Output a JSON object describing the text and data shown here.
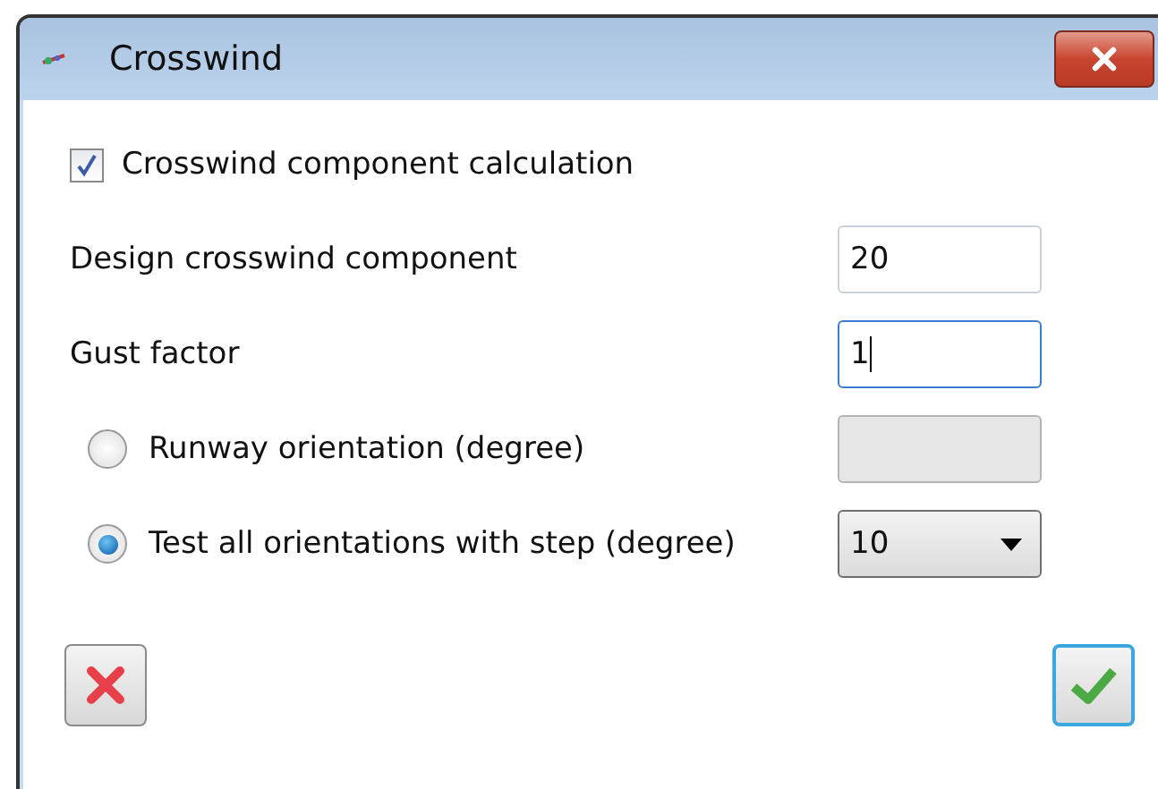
{
  "window": {
    "title": "Crosswind"
  },
  "enable": {
    "label": "Crosswind component calculation",
    "checked": true
  },
  "rows": [
    {
      "label": "Design crosswind component",
      "control": {
        "kind": "text",
        "value": "20",
        "focused": false,
        "disabled": false
      }
    },
    {
      "label": "Gust factor",
      "control": {
        "kind": "text",
        "value": "1",
        "focused": true,
        "disabled": false
      }
    },
    {
      "label": "Runway orientation (degree)",
      "radio": {
        "selected": false
      },
      "control": {
        "kind": "text",
        "focused": false,
        "disabled": true
      }
    },
    {
      "label": "Test all orientations with step (degree)",
      "radio": {
        "selected": true
      },
      "control": {
        "kind": "combo",
        "value": "10"
      }
    }
  ],
  "buttons": [
    {
      "kind": "cancel",
      "default": false
    },
    {
      "kind": "ok",
      "default": true
    }
  ]
}
